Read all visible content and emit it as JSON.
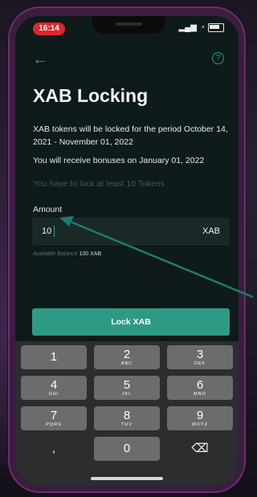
{
  "status_bar": {
    "time": "16:14"
  },
  "page": {
    "title": "XAB Locking",
    "description": "XAB tokens will be locked for the period October 14, 2021 - November 01, 2022",
    "bonus_note": "You will receive bonuses on January 01, 2022",
    "minimum_note": "You have to lock at least 10 Tokens"
  },
  "amount": {
    "label": "Amount",
    "value": "10",
    "unit": "XAB",
    "balance_label": "Available Balance",
    "balance_value": "100 XAB"
  },
  "actions": {
    "lock_label": "Lock XAB"
  },
  "keypad": {
    "keys": [
      {
        "num": "1",
        "letters": ""
      },
      {
        "num": "2",
        "letters": "ABC"
      },
      {
        "num": "3",
        "letters": "DEF"
      },
      {
        "num": "4",
        "letters": "GHI"
      },
      {
        "num": "5",
        "letters": "JKL"
      },
      {
        "num": "6",
        "letters": "MNO"
      },
      {
        "num": "7",
        "letters": "PQRS"
      },
      {
        "num": "8",
        "letters": "TUV"
      },
      {
        "num": "9",
        "letters": "WXYZ"
      },
      {
        "num": ",",
        "letters": ""
      },
      {
        "num": "0",
        "letters": ""
      },
      {
        "num": "⌫",
        "letters": ""
      }
    ]
  },
  "icons": {
    "back": "arrow-left-icon",
    "help": "question-circle-icon",
    "backspace": "backspace-icon"
  },
  "colors": {
    "accent": "#2f9a84",
    "screen_bg": "#0f1a1a",
    "time_pill": "#e0262e",
    "annotation_arrow": "#1f7a72"
  }
}
